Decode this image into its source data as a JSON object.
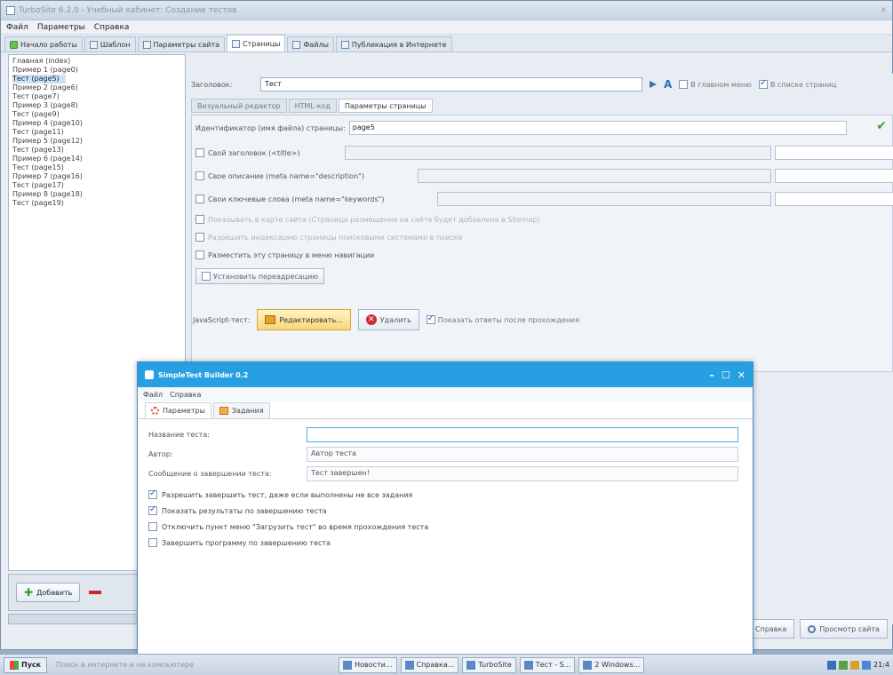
{
  "app": {
    "title": "TurboSite 6.2.0 - Учебный кабинет: Создание тестов",
    "menu": [
      "Файл",
      "Параметры",
      "Справка"
    ],
    "tabs": [
      "Начало работы",
      "Шаблон",
      "Параметры сайта",
      "Страницы",
      "Файлы",
      "Публикация в Интернете"
    ],
    "active_tab_index": 3
  },
  "left_list": {
    "items": [
      "Главная (index)",
      "Пример 1 (page0)",
      "Тест (page5)",
      "Пример 2 (page6)",
      "Тест (page7)",
      "Пример 3 (page8)",
      "Тест (page9)",
      "Пример 4 (page10)",
      "Тест (page11)",
      "Пример 5 (page12)",
      "Тест (page13)",
      "Пример 6 (page14)",
      "Тест (page15)",
      "Пример 7 (page16)",
      "Тест (page17)",
      "Пример 8 (page18)",
      "Тест (page19)"
    ],
    "selected_index": 2,
    "add_label": "Добавить"
  },
  "page_editor": {
    "title_label": "Заголовок:",
    "title_value": "Тест",
    "cb_in_menu": "В главном меню",
    "cb_in_list": "В списке страниц",
    "inner_tabs": [
      "Визуальный редактор",
      "HTML-код",
      "Параметры страницы"
    ],
    "active_inner_tab": 2,
    "filename_label": "Идентификатор (имя файла) страницы:",
    "filename_value": "page5",
    "opt_title": "Свой заголовок (<title>)",
    "opt_desc": "Свое описание (meta name=\"description\")",
    "opt_keys": "Свои ключевые слова (meta name=\"keywords\")",
    "opt_dis1": "Показывать в карте сайта (Страница размещения на сайте будет добавлена в Sitemap)",
    "opt_dis2": "Разрешить индексацию страницы поисковыми системами в поиске",
    "opt_noindex": "Разместить эту страницу в меню навигации",
    "forward_button": "Установить переадресацию",
    "js_label": "JavaScript-тест:",
    "edit_button": "Редактировать...",
    "delete_button": "Удалить",
    "cb_show_after": "Показать ответы после прохождения"
  },
  "right_buttons": [
    "Справка",
    "Просмотр сайта"
  ],
  "dialog": {
    "title": "SimpleTest Builder 0.2",
    "menu": [
      "Файл",
      "Справка"
    ],
    "tabs": [
      "Параметры",
      "Задания"
    ],
    "active_tab": 0,
    "fields": [
      {
        "label": "Название теста:",
        "value": ""
      },
      {
        "label": "Автор:",
        "value": "Автор теста"
      },
      {
        "label": "Сообщение о завершении теста:",
        "value": "Тест завершен!"
      }
    ],
    "checks": [
      {
        "label": "Разрешить завершить тест, даже если выполнены не все задания",
        "checked": true
      },
      {
        "label": "Показать результаты по завершению теста",
        "checked": true
      },
      {
        "label": "Отключить пункт меню \"Загрузить тест\" во время прохождения теста",
        "checked": false
      },
      {
        "label": "Завершить программу по завершению теста",
        "checked": false
      }
    ]
  },
  "taskbar": {
    "start": "Пуск",
    "search_placeholder": "Поиск в интернете и на компьютере",
    "items": [
      "Новости...",
      "Справка...",
      "TurboSite",
      "Тест - S...",
      "2 Windows..."
    ],
    "clock": "21:4"
  }
}
